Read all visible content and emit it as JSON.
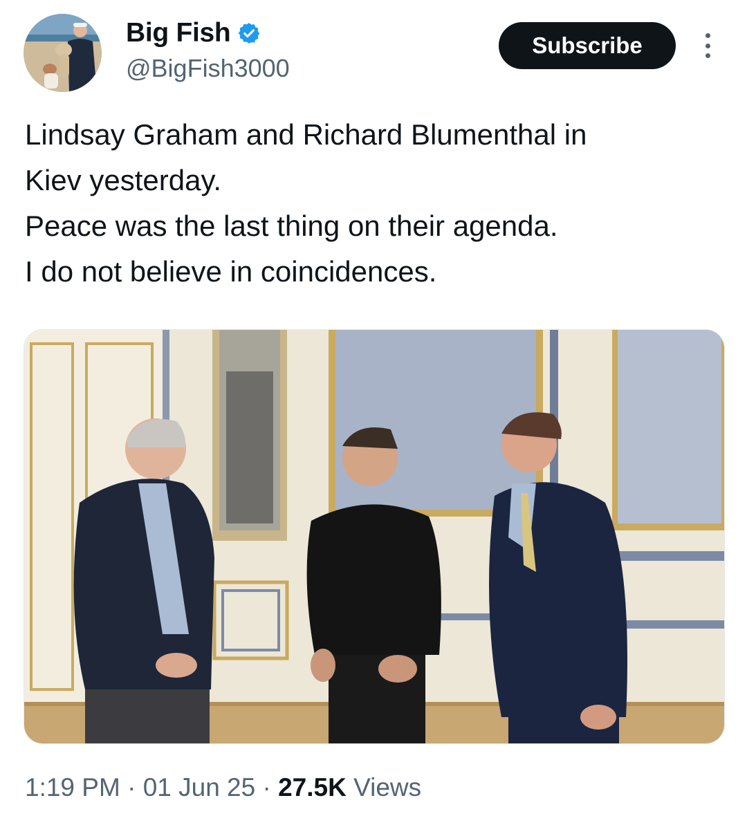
{
  "author": {
    "display_name": "Big Fish",
    "handle": "@BigFish3000",
    "verified": true,
    "verified_color": "#1d9bf0"
  },
  "actions": {
    "subscribe_label": "Subscribe",
    "more_icon": "more-vertical-icon"
  },
  "tweet": {
    "lines": [
      "Lindsay Graham and Richard Blumenthal in",
      "Kiev yesterday.",
      "Peace was the last thing on their agenda.",
      "I do not believe in coincidences."
    ]
  },
  "meta": {
    "time": "1:19 PM",
    "separator": "·",
    "date": "01 Jun 25",
    "views_count": "27.5K",
    "views_label": "Views"
  },
  "colors": {
    "text_primary": "#0f1419",
    "text_secondary": "#536471",
    "button_bg": "#0f1419"
  }
}
